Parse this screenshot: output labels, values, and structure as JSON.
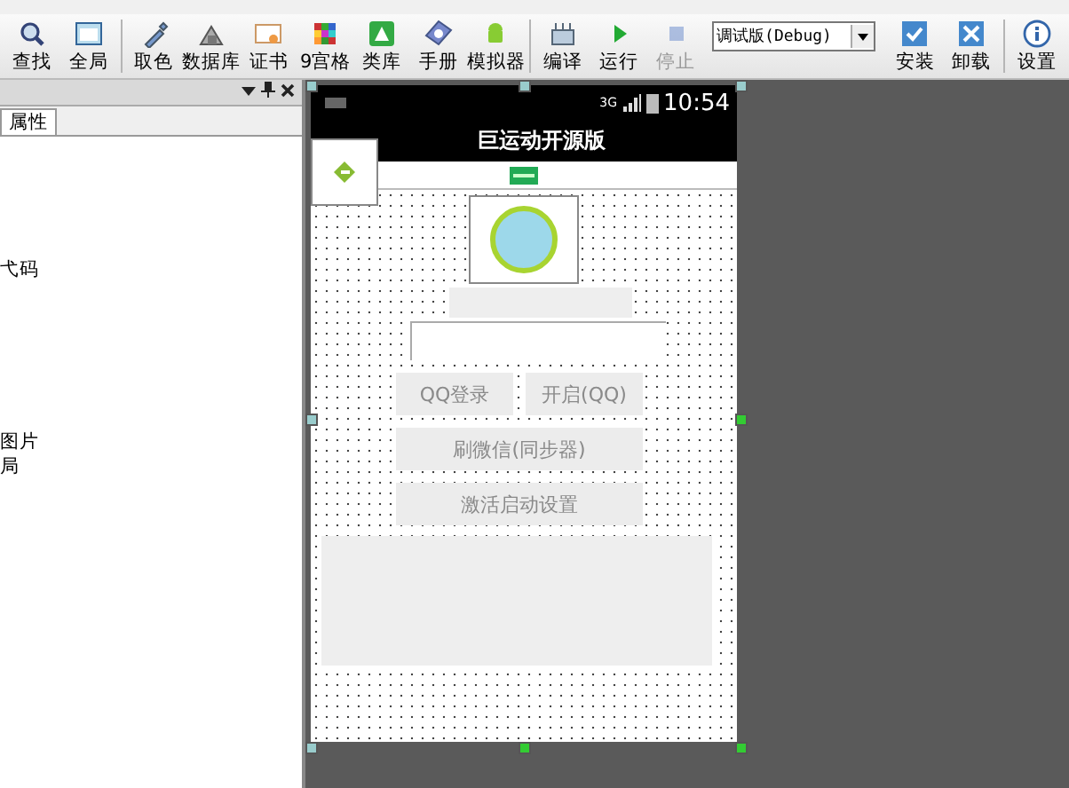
{
  "toolbar": [
    {
      "kind": "button",
      "label": "查找",
      "disabled": false
    },
    {
      "kind": "button",
      "label": "全局",
      "disabled": false
    },
    {
      "kind": "separator"
    },
    {
      "kind": "button",
      "label": "取色",
      "disabled": false
    },
    {
      "kind": "button",
      "label": "数据库",
      "disabled": false
    },
    {
      "kind": "button",
      "label": "证书",
      "disabled": false
    },
    {
      "kind": "button",
      "label": "9宫格",
      "disabled": false
    },
    {
      "kind": "button",
      "label": "类库",
      "disabled": false
    },
    {
      "kind": "button",
      "label": "手册",
      "disabled": false
    },
    {
      "kind": "button",
      "label": "模拟器",
      "disabled": false
    },
    {
      "kind": "separator"
    },
    {
      "kind": "button",
      "label": "编译",
      "disabled": false
    },
    {
      "kind": "button",
      "label": "运行",
      "disabled": false
    },
    {
      "kind": "button",
      "label": "停止",
      "disabled": true
    },
    {
      "kind": "select",
      "value": "调试版(Debug)"
    },
    {
      "kind": "button",
      "label": "安装",
      "disabled": false
    },
    {
      "kind": "button",
      "label": "卸载",
      "disabled": false
    },
    {
      "kind": "separator"
    },
    {
      "kind": "button",
      "label": "设置",
      "disabled": false
    }
  ],
  "panel": {
    "tabs": [
      {
        "label": "属性",
        "selected": true
      }
    ],
    "items": [
      {
        "label": "弋码"
      },
      {
        "label": "图片"
      },
      {
        "label": "局"
      }
    ]
  },
  "phone": {
    "time": "10:54",
    "network": "3G",
    "title": "巨运动开源版",
    "buttons": [
      {
        "label": "QQ登录"
      },
      {
        "label": "开启(QQ)"
      },
      {
        "label": "刷微信(同步器)"
      },
      {
        "label": "激活启动设置"
      }
    ]
  }
}
